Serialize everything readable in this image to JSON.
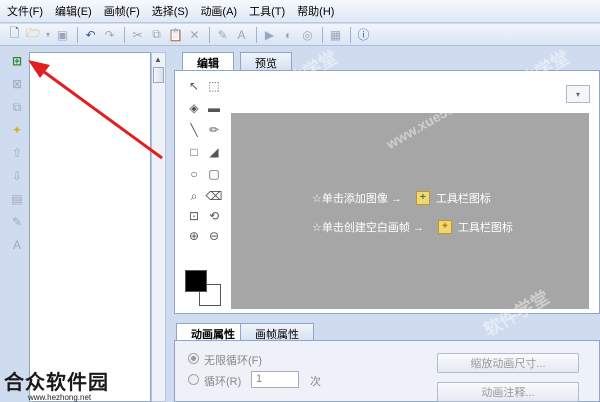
{
  "menu": {
    "items": [
      "文件(F)",
      "编辑(E)",
      "画帧(F)",
      "选择(S)",
      "动画(A)",
      "工具(T)",
      "帮助(H)"
    ]
  },
  "tabs": {
    "edit": "编辑",
    "preview": "预览"
  },
  "canvas": {
    "hint1_text": "☆单击添加图像 →",
    "hint1_suffix": "工具栏图标",
    "hint2_text": "☆单击创建空白画帧 →",
    "hint2_suffix": "工具栏图标"
  },
  "props": {
    "tab_animation": "动画属性",
    "tab_frame": "画帧属性",
    "loop_infinite": "无限循环(F)",
    "loop": "循环(R)",
    "loop_count": "1",
    "loop_unit": "次",
    "btn_resize": "缩放动画尺寸...",
    "btn_comment": "动画注释..."
  },
  "branding": {
    "name": "合众软件园",
    "url": "www.hezhong.net",
    "watermark": "软件学堂",
    "watermark_url": "www.xue51.com"
  },
  "colors": {
    "canvas": "#a6a6a6",
    "arrow": "#e02020",
    "foreground": "#000000",
    "background": "#ffffff"
  }
}
